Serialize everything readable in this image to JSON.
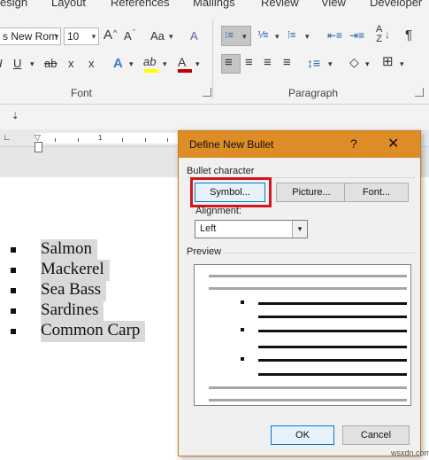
{
  "ribbon": {
    "tabs": [
      "esign",
      "Layout",
      "References",
      "Mailings",
      "Review",
      "View",
      "Developer"
    ],
    "font_name": "s New Rom",
    "font_size": "10",
    "font_group_label": "Font",
    "paragraph_group_label": "Paragraph",
    "icons": {
      "grow_font": "A",
      "shrink_font": "A",
      "change_case": "Aa",
      "clear_format": "A",
      "italic": "I",
      "underline": "U",
      "strikethrough": "ab",
      "subscript": "x",
      "superscript": "x",
      "text_effects": "A",
      "font_color": "A",
      "highlight": "ab",
      "pilcrow": "¶",
      "sort": "↓",
      "qat_arrow": "⇣"
    },
    "accent_colors": {
      "highlight": "#ffff00",
      "font_color": "#c00000",
      "selected": "#c5c5c5"
    }
  },
  "document": {
    "list_items": [
      "Salmon",
      "Mackerel",
      "Sea Bass",
      "Sardines",
      "Common Carp"
    ]
  },
  "dialog": {
    "title": "Define New Bullet",
    "help": "?",
    "close": "✕",
    "bullet_character_label": "Bullet character",
    "symbol_button": "Symbol...",
    "picture_button": "Picture...",
    "font_button": "Font...",
    "alignment_label": "Alignment:",
    "alignment_value": "Left",
    "preview_label": "Preview",
    "ok_button": "OK",
    "cancel_button": "Cancel",
    "title_color": "#de8c26",
    "highlight_color": "#d0161e"
  },
  "watermark": "wsxdn.com"
}
